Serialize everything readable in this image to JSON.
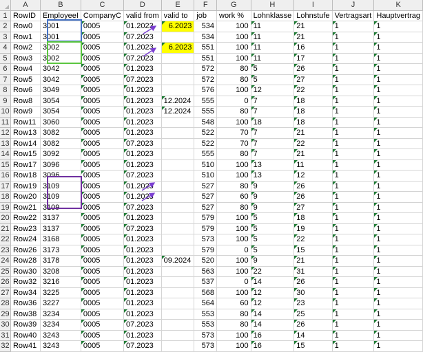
{
  "columns": [
    "A",
    "B",
    "C",
    "D",
    "E",
    "F",
    "G",
    "H",
    "I",
    "J",
    "K"
  ],
  "headers": [
    "RowID",
    "EmployeeI",
    "CompanyC",
    "valid from",
    "valid to",
    "job",
    "work %",
    "Lohnklasse",
    "Lohnstufe",
    "Vertragsart",
    "Hauptvertrag"
  ],
  "rows": [
    {
      "n": "2",
      "cells": [
        "Row0",
        "3001",
        "0005",
        "01.2023",
        "6.2023",
        "534",
        "100",
        "11",
        "21",
        "1",
        "1"
      ]
    },
    {
      "n": "3",
      "cells": [
        "Row1",
        "3001",
        "0005",
        "07.2023",
        "",
        "534",
        "100",
        "11",
        "21",
        "1",
        "1"
      ]
    },
    {
      "n": "4",
      "cells": [
        "Row2",
        "3002",
        "0005",
        "01.2023",
        "6.2023",
        "551",
        "100",
        "11",
        "16",
        "1",
        "1"
      ]
    },
    {
      "n": "5",
      "cells": [
        "Row3",
        "3002",
        "0005",
        "07.2023",
        "",
        "551",
        "100",
        "11",
        "17",
        "1",
        "1"
      ]
    },
    {
      "n": "6",
      "cells": [
        "Row4",
        "3042",
        "0005",
        "01.2023",
        "",
        "572",
        "80",
        "5",
        "26",
        "1",
        "1"
      ]
    },
    {
      "n": "7",
      "cells": [
        "Row5",
        "3042",
        "0005",
        "07.2023",
        "",
        "572",
        "80",
        "5",
        "27",
        "1",
        "1"
      ]
    },
    {
      "n": "8",
      "cells": [
        "Row6",
        "3049",
        "0005",
        "01.2023",
        "",
        "576",
        "100",
        "12",
        "22",
        "1",
        "1"
      ]
    },
    {
      "n": "9",
      "cells": [
        "Row8",
        "3054",
        "0005",
        "01.2023",
        "12.2024",
        "555",
        "0",
        "7",
        "18",
        "1",
        "1"
      ]
    },
    {
      "n": "10",
      "cells": [
        "Row9",
        "3054",
        "0005",
        "01.2023",
        "12.2024",
        "555",
        "80",
        "7",
        "18",
        "1",
        "1"
      ]
    },
    {
      "n": "11",
      "cells": [
        "Row11",
        "3060",
        "0005",
        "01.2023",
        "",
        "548",
        "100",
        "18",
        "18",
        "1",
        "1"
      ]
    },
    {
      "n": "12",
      "cells": [
        "Row13",
        "3082",
        "0005",
        "01.2023",
        "",
        "522",
        "70",
        "7",
        "21",
        "1",
        "1"
      ]
    },
    {
      "n": "13",
      "cells": [
        "Row14",
        "3082",
        "0005",
        "07.2023",
        "",
        "522",
        "70",
        "7",
        "22",
        "1",
        "1"
      ]
    },
    {
      "n": "14",
      "cells": [
        "Row15",
        "3092",
        "0005",
        "01.2023",
        "",
        "555",
        "80",
        "7",
        "21",
        "1",
        "1"
      ]
    },
    {
      "n": "15",
      "cells": [
        "Row17",
        "3096",
        "0005",
        "01.2023",
        "",
        "510",
        "100",
        "13",
        "11",
        "1",
        "1"
      ]
    },
    {
      "n": "16",
      "cells": [
        "Row18",
        "3096",
        "0005",
        "07.2023",
        "",
        "510",
        "100",
        "13",
        "12",
        "1",
        "1"
      ]
    },
    {
      "n": "17",
      "cells": [
        "Row19",
        "3109",
        "0005",
        "01.2023",
        "",
        "527",
        "80",
        "9",
        "26",
        "1",
        "1"
      ]
    },
    {
      "n": "18",
      "cells": [
        "Row20",
        "3109",
        "0005",
        "01.2023",
        "",
        "527",
        "60",
        "9",
        "26",
        "1",
        "1"
      ]
    },
    {
      "n": "19",
      "cells": [
        "Row21",
        "3109",
        "0005",
        "07.2023",
        "",
        "527",
        "80",
        "9",
        "27",
        "1",
        "1"
      ]
    },
    {
      "n": "20",
      "cells": [
        "Row22",
        "3137",
        "0005",
        "01.2023",
        "",
        "579",
        "100",
        "5",
        "18",
        "1",
        "1"
      ]
    },
    {
      "n": "21",
      "cells": [
        "Row23",
        "3137",
        "0005",
        "07.2023",
        "",
        "579",
        "100",
        "5",
        "19",
        "1",
        "1"
      ]
    },
    {
      "n": "22",
      "cells": [
        "Row24",
        "3168",
        "0005",
        "01.2023",
        "",
        "573",
        "100",
        "5",
        "22",
        "1",
        "1"
      ]
    },
    {
      "n": "23",
      "cells": [
        "Row26",
        "3173",
        "0005",
        "01.2023",
        "",
        "579",
        "0",
        "5",
        "15",
        "1",
        "1"
      ]
    },
    {
      "n": "24",
      "cells": [
        "Row28",
        "3178",
        "0005",
        "01.2023",
        "09.2024",
        "520",
        "100",
        "9",
        "21",
        "1",
        "1"
      ]
    },
    {
      "n": "25",
      "cells": [
        "Row30",
        "3208",
        "0005",
        "01.2023",
        "",
        "563",
        "100",
        "22",
        "31",
        "1",
        "1"
      ]
    },
    {
      "n": "26",
      "cells": [
        "Row32",
        "3216",
        "0005",
        "01.2023",
        "",
        "537",
        "0",
        "14",
        "26",
        "1",
        "1"
      ]
    },
    {
      "n": "27",
      "cells": [
        "Row34",
        "3225",
        "0005",
        "01.2023",
        "",
        "568",
        "100",
        "12",
        "30",
        "1",
        "1"
      ]
    },
    {
      "n": "28",
      "cells": [
        "Row36",
        "3227",
        "0005",
        "01.2023",
        "",
        "564",
        "60",
        "12",
        "23",
        "1",
        "1"
      ]
    },
    {
      "n": "29",
      "cells": [
        "Row38",
        "3234",
        "0005",
        "01.2023",
        "",
        "553",
        "80",
        "14",
        "25",
        "1",
        "1"
      ]
    },
    {
      "n": "30",
      "cells": [
        "Row39",
        "3234",
        "0005",
        "07.2023",
        "",
        "553",
        "80",
        "14",
        "26",
        "1",
        "1"
      ]
    },
    {
      "n": "31",
      "cells": [
        "Row40",
        "3243",
        "0005",
        "01.2023",
        "",
        "573",
        "100",
        "16",
        "14",
        "1",
        "1"
      ]
    },
    {
      "n": "32",
      "cells": [
        "Row41",
        "3243",
        "0005",
        "07.2023",
        "",
        "573",
        "100",
        "16",
        "15",
        "1",
        "1"
      ]
    }
  ],
  "colors": {
    "highlight": "#ffff00",
    "box_blue": "#4472c4",
    "box_green": "#5cc640",
    "box_purple": "#7030a0",
    "arrow": "#7b3fd1"
  }
}
